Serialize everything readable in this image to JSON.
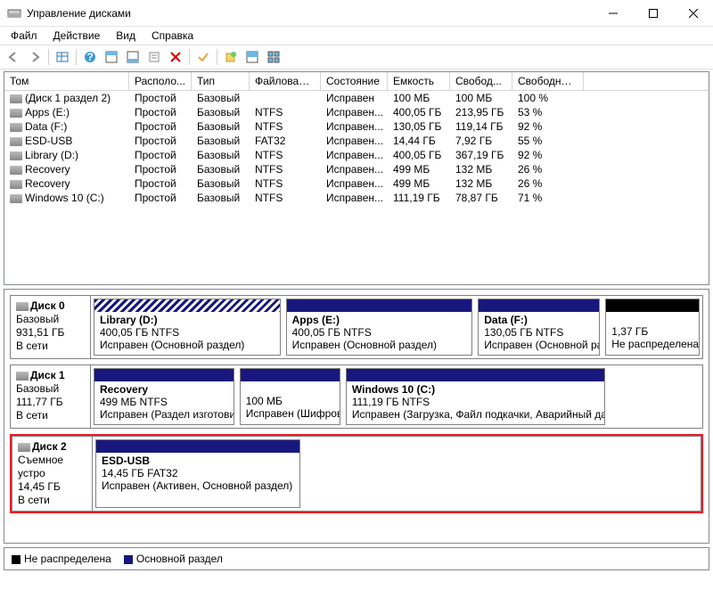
{
  "window": {
    "title": "Управление дисками"
  },
  "menu": {
    "file": "Файл",
    "action": "Действие",
    "view": "Вид",
    "help": "Справка"
  },
  "columns": {
    "tom": "Том",
    "raspl": "Располо...",
    "tip": "Тип",
    "fs": "Файловая с...",
    "sost": "Состояние",
    "emk": "Емкость",
    "svob": "Свобод...",
    "svobp": "Свободно %"
  },
  "rows": [
    {
      "tom": "(Диск 1 раздел 2)",
      "raspl": "Простой",
      "tip": "Базовый",
      "fs": "",
      "sost": "Исправен",
      "emk": "100 МБ",
      "svob": "100 МБ",
      "svobp": "100 %"
    },
    {
      "tom": "Apps (E:)",
      "raspl": "Простой",
      "tip": "Базовый",
      "fs": "NTFS",
      "sost": "Исправен...",
      "emk": "400,05 ГБ",
      "svob": "213,95 ГБ",
      "svobp": "53 %"
    },
    {
      "tom": "Data (F:)",
      "raspl": "Простой",
      "tip": "Базовый",
      "fs": "NTFS",
      "sost": "Исправен...",
      "emk": "130,05 ГБ",
      "svob": "119,14 ГБ",
      "svobp": "92 %"
    },
    {
      "tom": "ESD-USB",
      "raspl": "Простой",
      "tip": "Базовый",
      "fs": "FAT32",
      "sost": "Исправен...",
      "emk": "14,44 ГБ",
      "svob": "7,92 ГБ",
      "svobp": "55 %"
    },
    {
      "tom": "Library (D:)",
      "raspl": "Простой",
      "tip": "Базовый",
      "fs": "NTFS",
      "sost": "Исправен...",
      "emk": "400,05 ГБ",
      "svob": "367,19 ГБ",
      "svobp": "92 %"
    },
    {
      "tom": "Recovery",
      "raspl": "Простой",
      "tip": "Базовый",
      "fs": "NTFS",
      "sost": "Исправен...",
      "emk": "499 МБ",
      "svob": "132 МБ",
      "svobp": "26 %"
    },
    {
      "tom": "Recovery",
      "raspl": "Простой",
      "tip": "Базовый",
      "fs": "NTFS",
      "sost": "Исправен...",
      "emk": "499 МБ",
      "svob": "132 МБ",
      "svobp": "26 %"
    },
    {
      "tom": "Windows 10 (C:)",
      "raspl": "Простой",
      "tip": "Базовый",
      "fs": "NTFS",
      "sost": "Исправен...",
      "emk": "111,19 ГБ",
      "svob": "78,87 ГБ",
      "svobp": "71 %"
    }
  ],
  "disk0": {
    "name": "Диск 0",
    "type": "Базовый",
    "size": "931,51 ГБ",
    "status": "В сети",
    "p1": {
      "title": "Library  (D:)",
      "line2": "400,05 ГБ NTFS",
      "line3": "Исправен (Основной раздел)"
    },
    "p2": {
      "title": "Apps  (E:)",
      "line2": "400,05 ГБ NTFS",
      "line3": "Исправен (Основной раздел)"
    },
    "p3": {
      "title": "Data  (F:)",
      "line2": "130,05 ГБ NTFS",
      "line3": "Исправен (Основной раздел)"
    },
    "p4": {
      "line2": "1,37 ГБ",
      "line3": "Не распределена"
    }
  },
  "disk1": {
    "name": "Диск 1",
    "type": "Базовый",
    "size": "111,77 ГБ",
    "status": "В сети",
    "p1": {
      "title": "Recovery",
      "line2": "499 МБ NTFS",
      "line3": "Исправен (Раздел изготовит"
    },
    "p2": {
      "line2": "100 МБ",
      "line3": "Исправен (Шифров"
    },
    "p3": {
      "title": "Windows 10  (C:)",
      "line2": "111,19 ГБ NTFS",
      "line3": "Исправен (Загрузка, Файл подкачки, Аварийный дамп п"
    }
  },
  "disk2": {
    "name": "Диск 2",
    "type": "Съемное устро",
    "size": "14,45 ГБ",
    "status": "В сети",
    "p1": {
      "title": "ESD-USB",
      "line2": "14,45 ГБ FAT32",
      "line3": "Исправен (Активен, Основной раздел)"
    }
  },
  "legend": {
    "unalloc": "Не распределена",
    "primary": "Основной раздел"
  },
  "colors": {
    "blue": "#17177d",
    "black": "#000000",
    "highlight": "#ee1c25"
  }
}
